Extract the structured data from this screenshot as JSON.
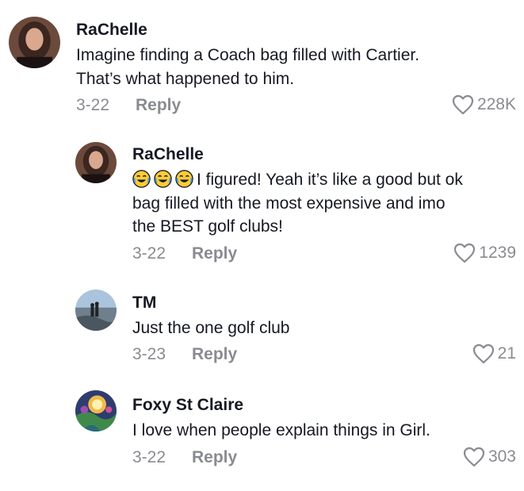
{
  "comments": [
    {
      "username": "RaChelle",
      "text_lines": [
        "Imagine finding a Coach bag filled with Cartier.",
        "That’s what happened to him."
      ],
      "date": "3-22",
      "reply_label": "Reply",
      "likes": "228K",
      "avatar_icon": "user-avatar-icon"
    },
    {
      "username": "RaChelle",
      "emoji": [
        "face-with-tears-of-joy-icon",
        "face-with-tears-of-joy-icon",
        "face-with-tears-of-joy-icon"
      ],
      "text_lines": [
        "I figured! Yeah it’s like a good but ok",
        "bag filled with the most expensive and imo",
        "the BEST golf clubs!"
      ],
      "date": "3-22",
      "reply_label": "Reply",
      "likes": "1239",
      "avatar_icon": "user-avatar-icon"
    },
    {
      "username": "TM",
      "text_lines": [
        "Just the one golf club"
      ],
      "date": "3-23",
      "reply_label": "Reply",
      "likes": "21",
      "avatar_icon": "user-avatar-icon"
    },
    {
      "username": "Foxy St Claire",
      "text_lines": [
        "I love when people explain things in Girl."
      ],
      "date": "3-22",
      "reply_label": "Reply",
      "likes": "303",
      "avatar_icon": "user-avatar-icon"
    }
  ],
  "colors": {
    "text": "#161823",
    "secondary": "#8a8b91"
  }
}
